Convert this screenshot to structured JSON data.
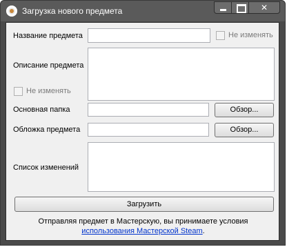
{
  "window": {
    "title": "Загрузка нового предмета",
    "minimize_glyph": "",
    "close_glyph": "✕"
  },
  "form": {
    "name_label": "Название предмета",
    "name_value": "",
    "name_nochange_label": "Не изменять",
    "description_label": "Описание предмета",
    "description_value": "",
    "description_nochange_label": "Не изменять",
    "folder_label": "Основная папка",
    "folder_value": "",
    "folder_browse_label": "Обзор...",
    "cover_label": "Обложка предмета",
    "cover_value": "",
    "cover_browse_label": "Обзор...",
    "changelog_label": "Список изменений",
    "changelog_value": "",
    "upload_label": "Загрузить"
  },
  "footer": {
    "agreement_text": "Отправляя предмет в Мастерскую, вы принимаете условия",
    "terms_link": "использования Мастерской Steam",
    "terms_suffix": "."
  }
}
